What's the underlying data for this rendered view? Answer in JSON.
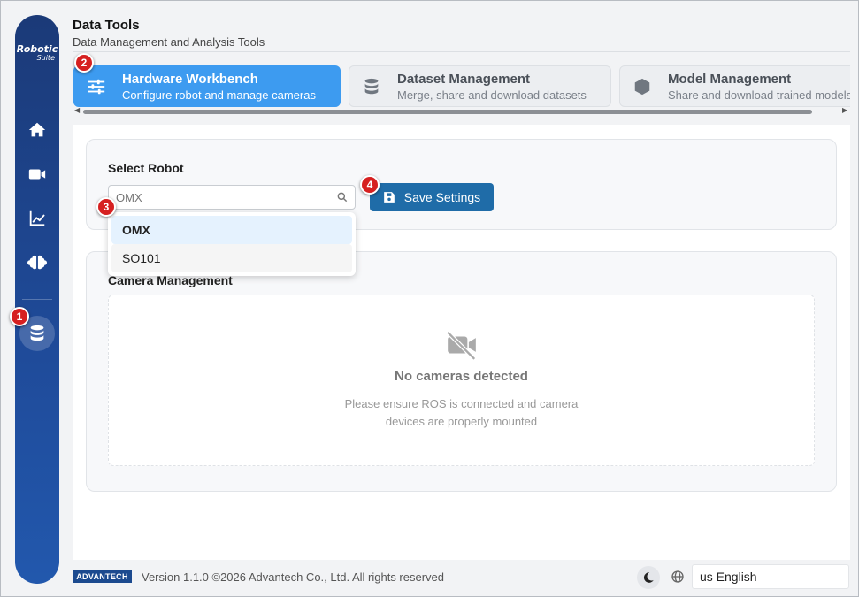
{
  "app": {
    "title": "Data Tools",
    "subtitle": "Data Management and Analysis Tools"
  },
  "sidebar": {
    "logo_main": "Robotic",
    "logo_sub": "Suite",
    "items": [
      {
        "icon": "home-icon"
      },
      {
        "icon": "video-camera-icon"
      },
      {
        "icon": "chart-line-icon"
      },
      {
        "icon": "brain-icon"
      },
      {
        "icon": "database-icon",
        "active": true
      }
    ]
  },
  "tabs": [
    {
      "label": "Hardware Workbench",
      "desc": "Configure robot and manage cameras",
      "icon": "sliders-icon",
      "active": true
    },
    {
      "label": "Dataset Management",
      "desc": "Merge, share and download datasets",
      "icon": "database-icon"
    },
    {
      "label": "Model Management",
      "desc": "Share and download trained models",
      "icon": "cube-icon"
    }
  ],
  "robot": {
    "label": "Select Robot",
    "placeholder": "OMX",
    "options": [
      "OMX",
      "SO101"
    ],
    "selected": "OMX",
    "save_label": "Save Settings"
  },
  "camera": {
    "label": "Camera Management",
    "empty_title": "No cameras detected",
    "empty_desc_line1": "Please ensure ROS is connected and camera",
    "empty_desc_line2": "devices are properly mounted"
  },
  "footer": {
    "brand": "ADVANTECH",
    "version": "Version 1.1.0 ©2026 Advantech Co., Ltd. All rights reserved",
    "language": "us  English"
  },
  "markers": [
    "1",
    "2",
    "3",
    "4"
  ],
  "colors": {
    "sidebar": "#1f4b9a",
    "active_tab": "#3d9bf0",
    "save_button": "#1f6ca8",
    "marker": "#d62020"
  }
}
